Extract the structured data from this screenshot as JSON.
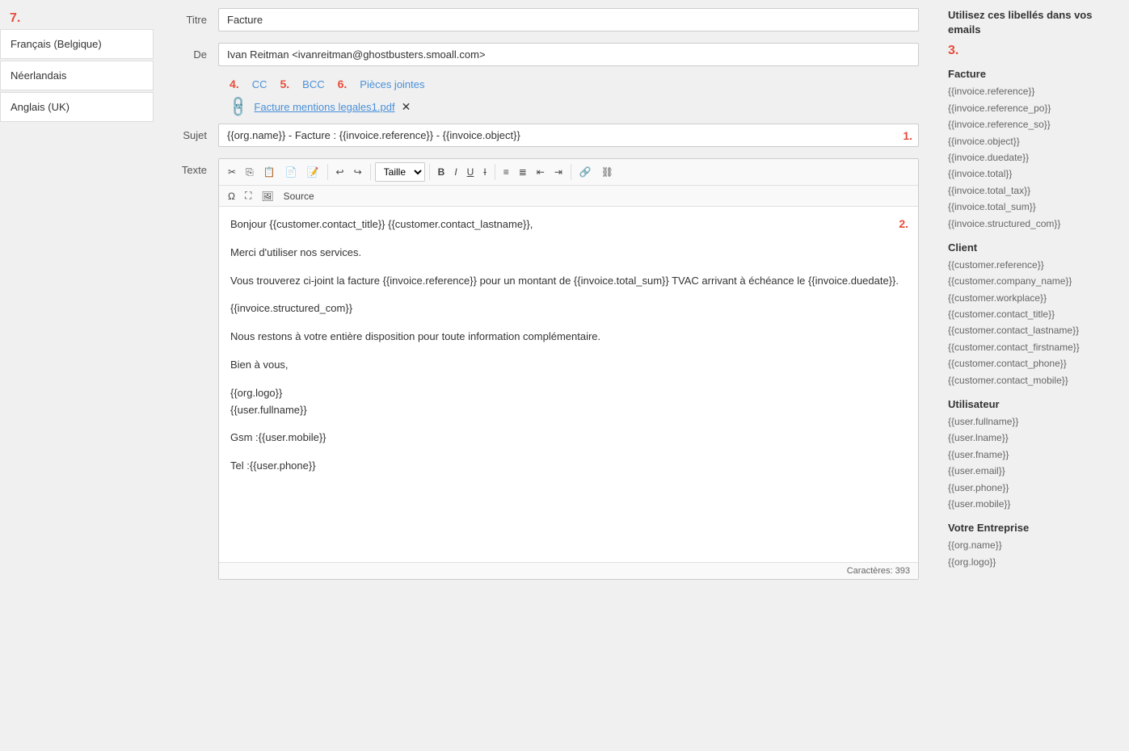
{
  "sidebar": {
    "number": "7.",
    "items": [
      {
        "label": "Français (Belgique)",
        "active": true
      },
      {
        "label": "Néerlandais",
        "active": false
      },
      {
        "label": "Anglais (UK)",
        "active": false
      }
    ]
  },
  "form": {
    "titre_label": "Titre",
    "titre_value": "Facture",
    "de_label": "De",
    "de_value": "Ivan Reitman <ivanreitman@ghostbusters.smoall.com>",
    "cc_label": "CC",
    "cc_number": "4.",
    "bcc_label": "BCC",
    "bcc_number": "5.",
    "pieces_label": "Pièces jointes",
    "pieces_number": "6.",
    "attachment_name": "Facture mentions legales1.pdf",
    "sujet_label": "Sujet",
    "sujet_value": "{{org.name}} - Facture : {{invoice.reference}} - {{invoice.object}}",
    "sujet_number": "1.",
    "texte_label": "Texte",
    "texte_number": "2.",
    "toolbar": {
      "taille_label": "Taille",
      "source_label": "Source"
    },
    "editor_content": [
      "Bonjour {{customer.contact_title}} {{customer.contact_lastname}},",
      "Merci d'utiliser nos services.",
      "Vous trouverez ci-joint la facture {{invoice.reference}} pour un montant de {{invoice.total_sum}} TVAC arrivant à échéance le {{invoice.duedate}}.",
      "{{invoice.structured_com}}",
      "Nous restons à votre entière disposition pour toute information complémentaire.",
      "Bien à vous,",
      "{{org.logo}}\n{{user.fullname}}",
      "Gsm :{{user.mobile}}",
      "Tel :{{user.phone}}"
    ],
    "caracteres_label": "Caractères: 393"
  },
  "right_panel": {
    "title": "Utilisez ces libellés dans vos emails",
    "number": "3.",
    "sections": [
      {
        "header": "Facture",
        "vars": [
          "{{invoice.reference}}",
          "{{invoice.reference_po}}",
          "{{invoice.reference_so}}",
          "{{invoice.object}}",
          "{{invoice.duedate}}",
          "{{invoice.total}}",
          "{{invoice.total_tax}}",
          "{{invoice.total_sum}}",
          "{{invoice.structured_com}}"
        ]
      },
      {
        "header": "Client",
        "vars": [
          "{{customer.reference}}",
          "{{customer.company_name}}",
          "{{customer.workplace}}",
          "{{customer.contact_title}}",
          "{{customer.contact_lastname}}",
          "{{customer.contact_firstname}}",
          "{{customer.contact_phone}}",
          "{{customer.contact_mobile}}"
        ]
      },
      {
        "header": "Utilisateur",
        "vars": [
          "{{user.fullname}}",
          "{{user.lname}}",
          "{{user.fname}}",
          "{{user.email}}",
          "{{user.phone}}",
          "{{user.mobile}}"
        ]
      },
      {
        "header": "Votre Entreprise",
        "vars": [
          "{{org.name}}",
          "{{org.logo}}"
        ]
      }
    ]
  }
}
